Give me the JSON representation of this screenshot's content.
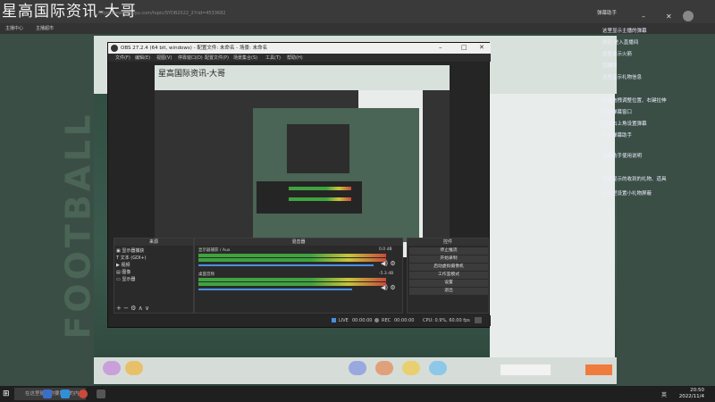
{
  "browser": {
    "overlay_text": "星高国际资讯-大哥",
    "url_partial": "https://www.douyu.com/topic/SYDB2022_2?rid=4533682",
    "bookmarks": [
      "主播中心",
      "主播超市"
    ],
    "top_right_label": "弹幕助手"
  },
  "obs": {
    "title": "OBS 27.2.4 (64 bit, windows) - 配置文件: 未命名 - 场景: 未命名",
    "menu": [
      "文件(F)",
      "编辑(E)",
      "视图(V)",
      "停靠窗口(D)",
      "配置文件(P)",
      "场景集合(S)",
      "工具(T)",
      "帮助(H)"
    ],
    "docks": {
      "sources_title": "来源",
      "mixer_title": "混音器",
      "controls_title": "控件"
    },
    "sources": [
      "显示器捕获",
      "文本 (GDI+)",
      "视频",
      "图像",
      "显示器"
    ],
    "mixer": [
      {
        "name": "显示器捕获 / Aux",
        "db": "0.0 dB"
      },
      {
        "name": "桌面音频",
        "db": "-5.3 dB"
      }
    ],
    "controls": [
      "停止推流",
      "开始录制",
      "启动虚拟摄像机",
      "工作室模式",
      "设置",
      "退出"
    ],
    "status": {
      "live_label": "LIVE",
      "live_time": "00:00:00",
      "rec_label": "REC",
      "rec_time": "00:00:00",
      "cpu": "CPU: 0.9%, 60.00 fps"
    }
  },
  "chat": [
    "这里显示主播的弹幕",
    "欢迎 进入直播间",
    "这里显示火箭",
    "直播间",
    "这里显示礼物信息",
    "左键拖拽调整位置、右键拉伸",
    "这是弹幕窗口",
    "点击右上角设置弹幕",
    "这是弹幕助手",
    "弹幕助手使用说明",
    "设置显示的收到的礼物、道具",
    "在这里设置小礼物屏蔽"
  ],
  "taskbar": {
    "search_placeholder": "在这里输入你要搜索的内容",
    "time": "20:50",
    "date": "2022/11/4",
    "lang": "英"
  }
}
